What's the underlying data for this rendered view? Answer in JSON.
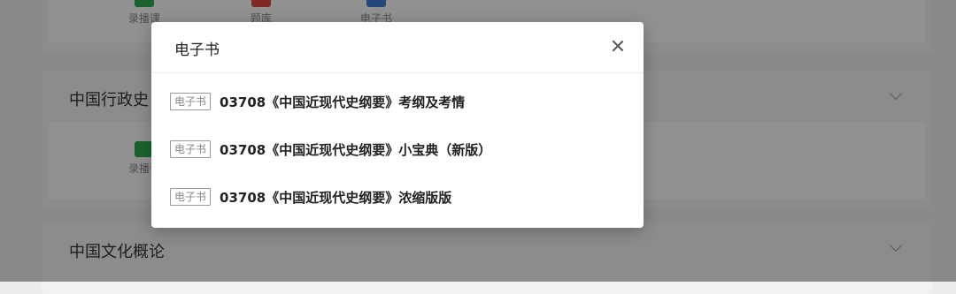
{
  "background": {
    "top_tools": [
      {
        "label": "录播课",
        "icon": "play-video-icon",
        "color": "#2fa84f"
      },
      {
        "label": "题库",
        "icon": "question-bank-icon",
        "color": "#e0483f"
      },
      {
        "label": "电子书",
        "icon": "ebook-icon",
        "color": "#3a7bd5"
      }
    ],
    "sections": [
      {
        "title": "中国行政史",
        "tool_label": "录播课",
        "tool_icon": "clapper-video-icon",
        "color": "#2fa84f"
      },
      {
        "title": "中国文化概论"
      }
    ]
  },
  "modal": {
    "title": "电子书",
    "close_icon": "close-icon",
    "items": [
      {
        "tag": "电子书",
        "text": "03708《中国近现代史纲要》考纲及考情"
      },
      {
        "tag": "电子书",
        "text": "03708《中国近现代史纲要》小宝典（新版）"
      },
      {
        "tag": "电子书",
        "text": "03708《中国近现代史纲要》浓缩版版"
      }
    ]
  }
}
